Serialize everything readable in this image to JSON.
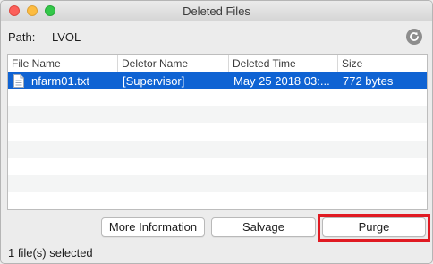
{
  "window": {
    "title": "Deleted Files"
  },
  "path": {
    "label": "Path:",
    "value": "LVOL"
  },
  "icons": {
    "refresh": "refresh-icon",
    "file": "document-icon"
  },
  "table": {
    "columns": [
      "File Name",
      "Deletor Name",
      "Deleted Time",
      "Size"
    ],
    "rows": [
      {
        "file_name": "nfarm01.txt",
        "deletor": "[Supervisor]",
        "deleted_time": "May 25 2018 03:...",
        "size": "772 bytes",
        "selected": true
      }
    ]
  },
  "buttons": {
    "more_info": "More Information",
    "salvage": "Salvage",
    "purge": "Purge"
  },
  "status": "1 file(s) selected",
  "colors": {
    "selection": "#0f63d3",
    "highlight": "#e01a22"
  }
}
